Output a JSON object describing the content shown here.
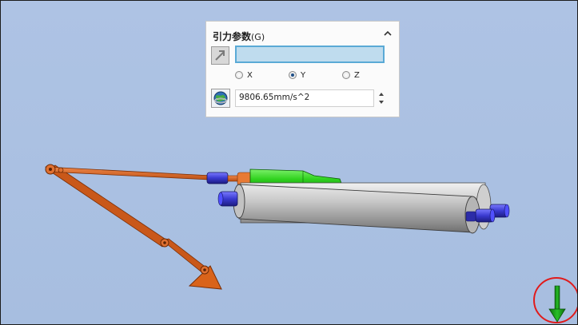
{
  "panel": {
    "title": "引力参数",
    "title_shortcut": "(G)",
    "direction_value": "",
    "axes": [
      {
        "label": "X",
        "selected": false
      },
      {
        "label": "Y",
        "selected": true
      },
      {
        "label": "Z",
        "selected": false
      }
    ],
    "gravity_value": "9806.65mm/s^2"
  },
  "icons": {
    "collapse": "chevron-up-icon",
    "direction": "direction-arrow-icon",
    "gravity": "globe-icon",
    "triad": "gravity-arrow-icon"
  },
  "colors": {
    "background": "#aec3e4",
    "linkage": "#d9631a",
    "cylinder_grey": "#b9b9b9",
    "cap_blue": "#3a3ad0",
    "green_part": "#2fd21e",
    "gravity_arrow": "#1b9b1b",
    "highlight_circle": "#e11b1b"
  }
}
